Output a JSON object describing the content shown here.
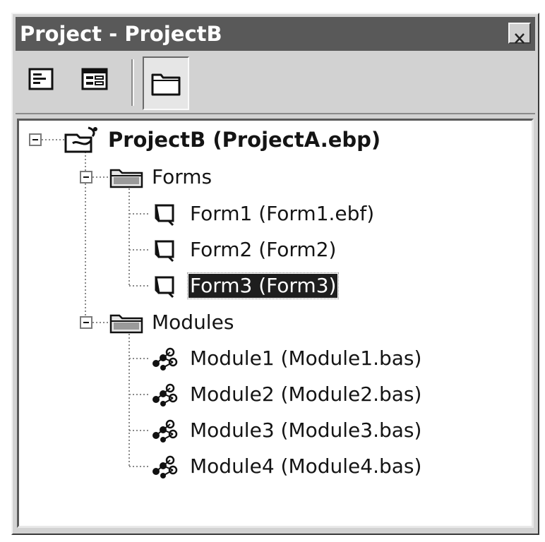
{
  "window": {
    "title": "Project - ProjectB"
  },
  "toolbar": {
    "buttons": [
      {
        "name": "view-code-icon"
      },
      {
        "name": "view-object-icon"
      },
      {
        "name": "toggle-folders-icon"
      }
    ]
  },
  "tree": {
    "root": {
      "label": "ProjectB (ProjectA.ebp)",
      "icon": "project-icon"
    },
    "folders": [
      {
        "label": "Forms",
        "icon": "folder-icon",
        "items": [
          {
            "label": "Form1 (Form1.ebf)",
            "icon": "form-icon",
            "selected": false
          },
          {
            "label": "Form2 (Form2)",
            "icon": "form-icon",
            "selected": false
          },
          {
            "label": "Form3 (Form3)",
            "icon": "form-icon",
            "selected": true
          }
        ]
      },
      {
        "label": "Modules",
        "icon": "folder-icon",
        "items": [
          {
            "label": "Module1 (Module1.bas)",
            "icon": "module-icon"
          },
          {
            "label": "Module2 (Module2.bas)",
            "icon": "module-icon"
          },
          {
            "label": "Module3 (Module3.bas)",
            "icon": "module-icon"
          },
          {
            "label": "Module4 (Module4.bas)",
            "icon": "module-icon"
          }
        ]
      }
    ]
  },
  "colors": {
    "titlebar": "#595959",
    "selection": "#1e1e1e",
    "chrome": "#d2d2d2"
  }
}
